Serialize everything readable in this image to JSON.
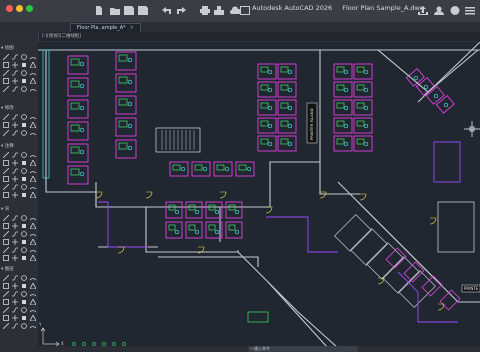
{
  "window": {
    "app_name": "Autodesk AutoCAD 2026",
    "file_name": "Floor Plan Sample_A.dwg"
  },
  "doc_tab": {
    "label": "Floor Pla..ample_A*",
    "close": "×"
  },
  "viewport": {
    "controls": "[-][俯视][二维线框]"
  },
  "palette": {
    "sections": [
      "绘图",
      "修改",
      "注释",
      "块",
      "图层"
    ]
  },
  "canvas": {
    "labels": {
      "printer_room": "PRINTER ISLAND",
      "printer_right": "PRINTE"
    }
  },
  "command": {
    "prompt": ">",
    "placeholder": "键入命令"
  },
  "ucs": {
    "x": "X",
    "y": "Y"
  },
  "colors": {
    "background": "#212730",
    "walls": "#c4c8cf",
    "cubicles": "#e040e0",
    "furniture": "#3fe06a",
    "chairs": "#4fe0e0",
    "doors": "#f0e04a",
    "accent": "#9848ff"
  }
}
